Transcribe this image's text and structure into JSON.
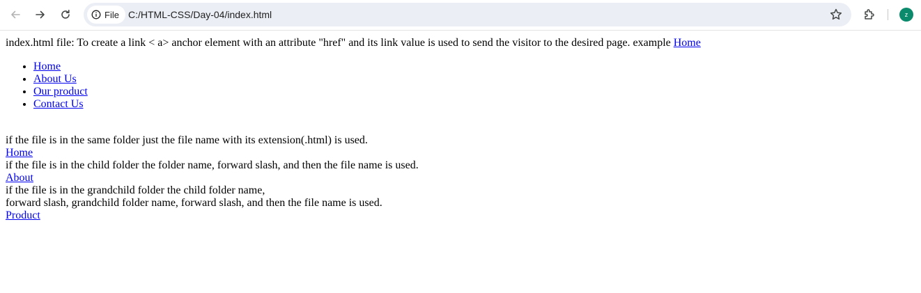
{
  "browser": {
    "chip_label": "File",
    "url": "C:/HTML-CSS/Day-04/index.html",
    "avatar_letter": "z",
    "accent_color": "#0b8a6c"
  },
  "page": {
    "intro_text": "index.html file: To create a link < a> anchor element with an attribute \"href\" and its link value is used to send the visitor to the desired page. example ",
    "intro_link": "Home",
    "nav_items": [
      "Home",
      "About Us",
      "Our product",
      "Contact Us"
    ],
    "same_folder_text": "if the file is in the same folder just the file name with its extension(.html) is used.",
    "same_folder_link": "Home",
    "child_folder_text": "if the file is in the child folder the folder name, forward slash, and then the file name is used.",
    "child_folder_link": "About",
    "grandchild_text_1": "if the file is in the grandchild folder the child folder name,",
    "grandchild_text_2": "forward slash, grandchild folder name, forward slash, and then the file name is used.",
    "grandchild_link": "Product"
  }
}
